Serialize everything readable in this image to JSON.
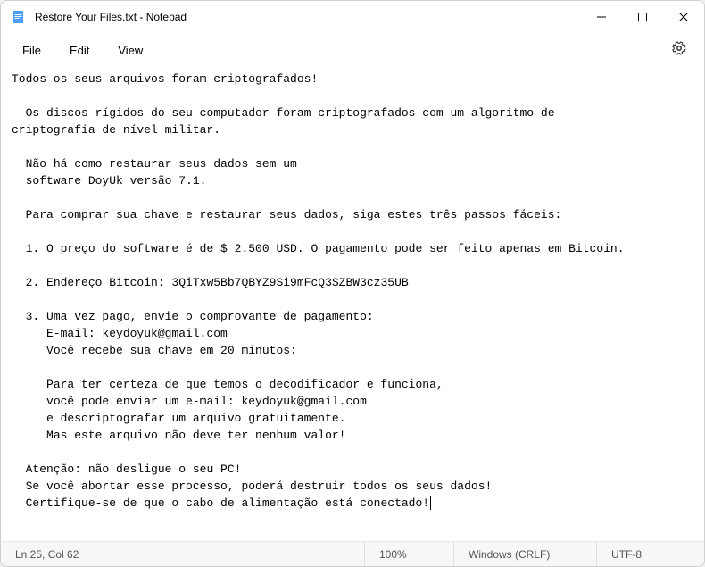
{
  "titlebar": {
    "title": "Restore Your Files.txt - Notepad",
    "icon_name": "notepad-icon"
  },
  "menu": {
    "file": "File",
    "edit": "Edit",
    "view": "View"
  },
  "document": {
    "text": "Todos os seus arquivos foram criptografados!\n\n  Os discos rígidos do seu computador foram criptografados com um algoritmo de\ncriptografia de nível militar.\n\n  Não há como restaurar seus dados sem um\n  software DoyUk versão 7.1.\n\n  Para comprar sua chave e restaurar seus dados, siga estes três passos fáceis:\n\n  1. O preço do software é de $ 2.500 USD. O pagamento pode ser feito apenas em Bitcoin.\n\n  2. Endereço Bitcoin: 3QiTxw5Bb7QBYZ9Si9mFcQ3SZBW3cz35UB\n\n  3. Uma vez pago, envie o comprovante de pagamento:\n     E-mail: keydoyuk@gmail.com\n     Você recebe sua chave em 20 minutos:\n\n     Para ter certeza de que temos o decodificador e funciona,\n     você pode enviar um e-mail: keydoyuk@gmail.com\n     e descriptografar um arquivo gratuitamente.\n     Mas este arquivo não deve ter nenhum valor!\n\n  Atenção: não desligue o seu PC!\n  Se você abortar esse processo, poderá destruir todos os seus dados!\n  Certifique-se de que o cabo de alimentação está conectado!"
  },
  "statusbar": {
    "position": "Ln 25, Col 62",
    "zoom": "100%",
    "line_ending": "Windows (CRLF)",
    "encoding": "UTF-8"
  }
}
